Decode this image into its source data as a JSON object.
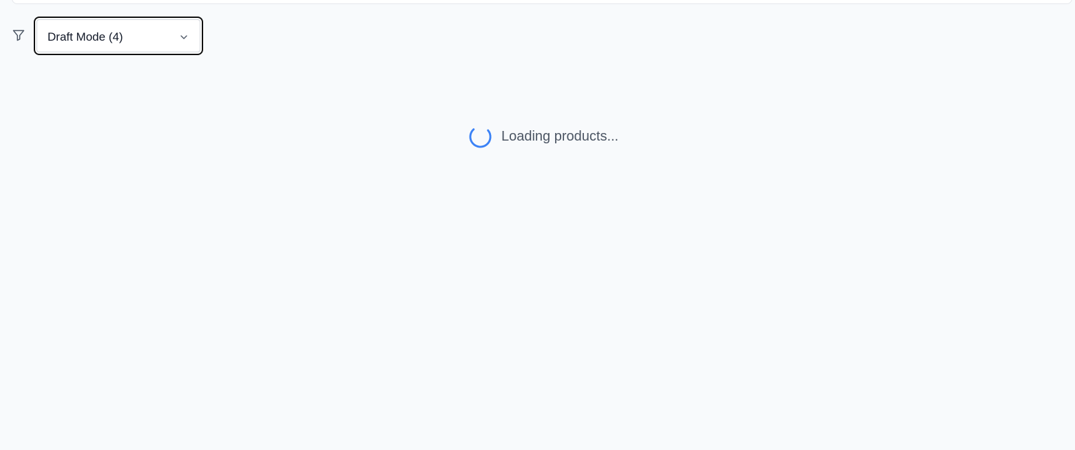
{
  "filter": {
    "icon": "filter-icon",
    "selected_label": "Draft Mode (4)",
    "dropdown_icon": "chevron-down-icon"
  },
  "status": {
    "loading_text": "Loading products...",
    "spinner_icon": "spinner-icon",
    "spinner_color": "#3b82f6"
  },
  "colors": {
    "background": "#f8fafc",
    "select_border": "#111111",
    "text_muted": "#4b5563"
  }
}
